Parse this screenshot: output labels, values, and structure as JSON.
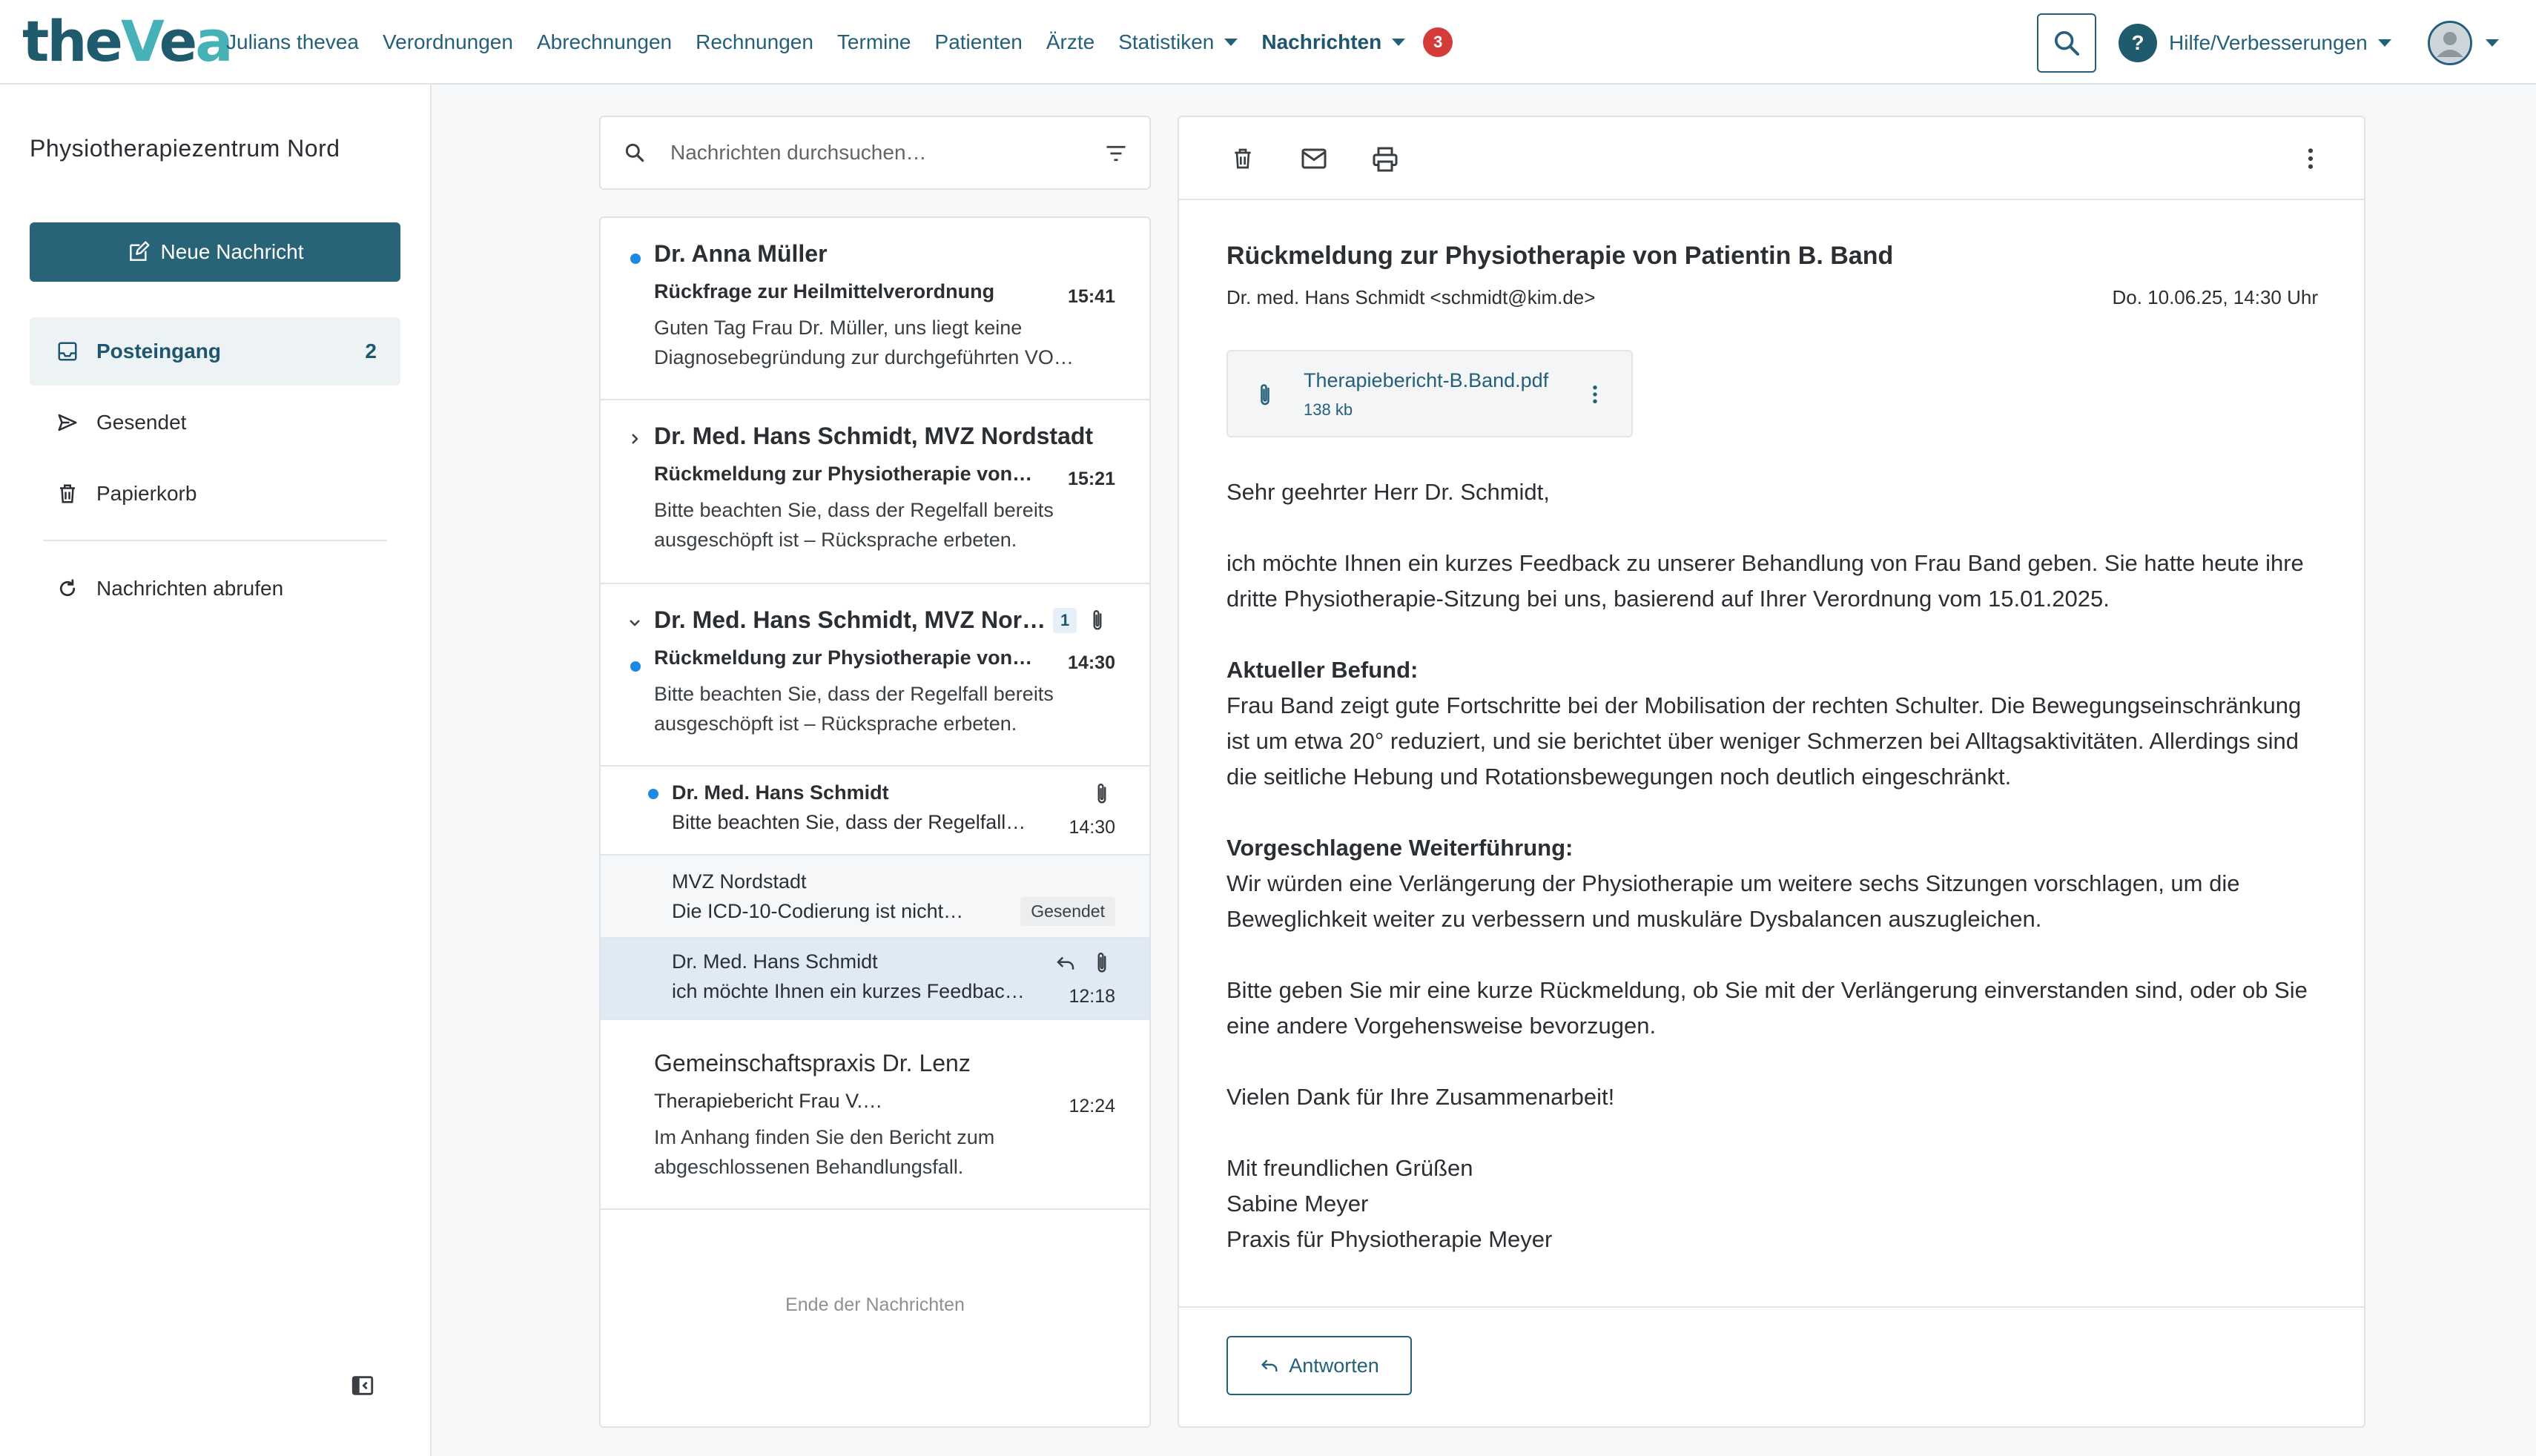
{
  "logo": {
    "part1": "the",
    "part2": "Vea",
    "part3": "a"
  },
  "nav": {
    "items": [
      "Julians thevea",
      "Verordnungen",
      "Abrechnungen",
      "Rechnungen",
      "Termine",
      "Patienten",
      "Ärzte"
    ],
    "statistiken": "Statistiken",
    "nachrichten": "Nachrichten",
    "nachrichten_badge": "3"
  },
  "header": {
    "help_icon": "?",
    "help_label": "Hilfe/Verbesserungen"
  },
  "sidebar": {
    "org_name": "Physiotherapiezentrum Nord",
    "new_message": "Neue Nachricht",
    "inbox": "Posteingang",
    "inbox_count": "2",
    "sent": "Gesendet",
    "trash": "Papierkorb",
    "fetch": "Nachrichten abrufen"
  },
  "search": {
    "placeholder": "Nachrichten durchsuchen…"
  },
  "messages": [
    {
      "sender": "Dr. Anna Müller",
      "subject": "Rückfrage zur Heilmittelverordnung",
      "time": "15:41",
      "preview": "Guten Tag Frau Dr. Müller, uns liegt keine Diagnosebegründung zur durchgeführten VO…"
    },
    {
      "sender": "Dr. Med. Hans Schmidt, MVZ Nordstadt",
      "subject": "Rückmeldung zur Physiotherapie von…",
      "time": "15:21",
      "preview": "Bitte beachten Sie, dass der Regelfall bereits ausgeschöpft ist – Rücksprache erbeten."
    },
    {
      "sender": "Dr. Med. Hans Schmidt, MVZ Nor…",
      "count": "1",
      "subject": "Rückmeldung zur Physiotherapie von…",
      "time": "14:30",
      "preview": "Bitte beachten Sie, dass der Regelfall bereits ausgeschöpft ist – Rücksprache erbeten."
    },
    {
      "sender": "Gemeinschaftspraxis Dr. Lenz",
      "subject": "Therapiebericht Frau V.…",
      "time": "12:24",
      "preview": "Im Anhang finden Sie den Bericht zum abgeschlossenen Behandlungsfall."
    }
  ],
  "thread": [
    {
      "sender": "Dr. Med. Hans Schmidt",
      "preview": "Bitte beachten Sie, dass der Regelfall…",
      "time": "14:30"
    },
    {
      "sender": "MVZ Nordstadt",
      "preview": "Die ICD-10-Codierung ist nicht…",
      "tag": "Gesendet"
    },
    {
      "sender": "Dr. Med. Hans Schmidt",
      "preview": "ich möchte Ihnen ein kurzes Feedbac…",
      "time": "12:18"
    }
  ],
  "list_end": "Ende der Nachrichten",
  "reader": {
    "subject": "Rückmeldung zur Physiotherapie von Patientin B. Band",
    "from": "Dr. med. Hans Schmidt <schmidt@kim.de>",
    "date": "Do. 10.06.25, 14:30 Uhr",
    "attachment_name": "Therapiebericht-B.Band.pdf",
    "attachment_size": "138 kb",
    "greeting": "Sehr geehrter Herr Dr. Schmidt,",
    "p1": "ich möchte Ihnen ein kurzes Feedback zu unserer Behandlung von Frau Band geben. Sie hatte heute ihre dritte Physiotherapie-Sitzung bei uns, basierend auf Ihrer Verordnung vom 15.01.2025.",
    "h1": "Aktueller Befund:",
    "p2": "Frau Band zeigt gute Fortschritte bei der Mobilisation der rechten Schulter. Die Bewegungseinschränkung ist um etwa 20° reduziert, und sie berichtet über weniger Schmerzen bei Alltagsaktivitäten. Allerdings sind die seitliche Hebung und Rotationsbewegungen noch deutlich eingeschränkt.",
    "h2": "Vorgeschlagene Weiterführung:",
    "p3": "Wir würden eine Verlängerung der Physiotherapie um weitere sechs Sitzungen vorschlagen, um die Beweglichkeit weiter zu verbessern und muskuläre Dysbalancen auszugleichen.",
    "p4": "Bitte geben Sie mir eine kurze Rückmeldung, ob Sie mit der Verlängerung einverstanden sind, oder ob Sie eine andere Vorgehensweise bevorzugen.",
    "p5": "Vielen Dank für Ihre Zusammenarbeit!",
    "closing": "Mit freundlichen Grüßen",
    "sig_name": "Sabine Meyer",
    "sig_practice": "Praxis für Physiotherapie Meyer",
    "reply": "Antworten"
  },
  "colors": {
    "brand": "#1f5a6d",
    "accent": "#46b1b6",
    "badge": "#d53b3b",
    "unread_dot": "#1e88e5",
    "selected": "#dfeaf4"
  }
}
